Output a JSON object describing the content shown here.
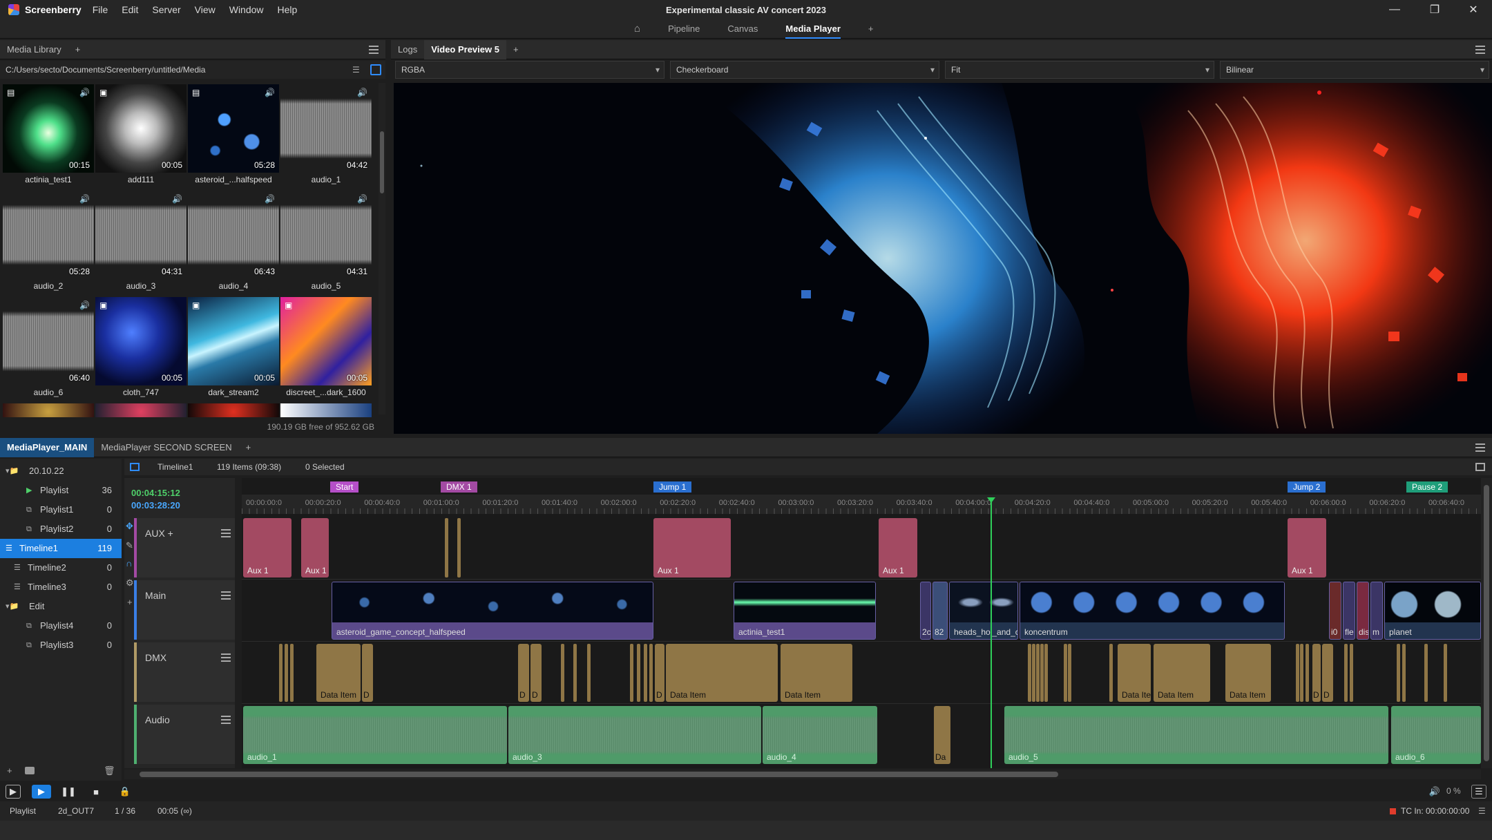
{
  "app": {
    "name": "Screenberry",
    "window_title": "Experimental classic AV concert 2023",
    "menu": [
      "File",
      "Edit",
      "Server",
      "View",
      "Window",
      "Help"
    ]
  },
  "workspace_tabs": [
    "Pipeline",
    "Canvas",
    "Media Player"
  ],
  "media_library": {
    "tab": "Media Library",
    "path": "C:/Users/secto/Documents/Screenberry/untitled/Media",
    "free_space": "190.19 GB free of 952.62 GB",
    "items": [
      {
        "name": "actinia_test1",
        "duration": "00:15"
      },
      {
        "name": "add111",
        "duration": "00:05"
      },
      {
        "name": "asteroid_...halfspeed",
        "duration": "05:28"
      },
      {
        "name": "audio_1",
        "duration": "04:42"
      },
      {
        "name": "audio_2",
        "duration": "05:28"
      },
      {
        "name": "audio_3",
        "duration": "04:31"
      },
      {
        "name": "audio_4",
        "duration": "06:43"
      },
      {
        "name": "audio_5",
        "duration": "04:31"
      },
      {
        "name": "audio_6",
        "duration": "06:40"
      },
      {
        "name": "cloth_747",
        "duration": "00:05"
      },
      {
        "name": "dark_stream2",
        "duration": "00:05"
      },
      {
        "name": "discreet_...dark_1600",
        "duration": "00:05"
      }
    ]
  },
  "preview": {
    "tabs": [
      "Logs",
      "Video Preview 5"
    ],
    "combos": [
      "RGBA",
      "Checkerboard",
      "Fit",
      "Bilinear"
    ]
  },
  "mediaplayer": {
    "tabs": [
      "MediaPlayer_MAIN",
      "MediaPlayer SECOND SCREEN"
    ],
    "tree": [
      {
        "label": "20.10.22",
        "count": ""
      },
      {
        "label": "Playlist",
        "count": "36"
      },
      {
        "label": "Playlist1",
        "count": "0"
      },
      {
        "label": "Playlist2",
        "count": "0"
      },
      {
        "label": "Timeline1",
        "count": "119"
      },
      {
        "label": "Timeline2",
        "count": "0"
      },
      {
        "label": "Timeline3",
        "count": "0"
      },
      {
        "label": "Edit",
        "count": ""
      },
      {
        "label": "Playlist4",
        "count": "0"
      },
      {
        "label": "Playlist3",
        "count": "0"
      }
    ],
    "timeline_name": "Timeline1",
    "items_info": "119 Items (09:38)",
    "selected_info": "0 Selected",
    "time_current": "00:04:15:12",
    "time_total": "00:03:28:20",
    "tracks": [
      "AUX +",
      "Main",
      "DMX",
      "Audio"
    ],
    "markers": [
      "Start",
      "DMX 1",
      "Jump 1",
      "Jump 2",
      "Pause 2"
    ],
    "ruler": [
      "00:00:00:0",
      "00:00:20:0",
      "00:00:40:0",
      "00:01:00:0",
      "00:01:20:0",
      "00:01:40:0",
      "00:02:00:0",
      "00:02:20:0",
      "00:02:40:0",
      "00:03:00:0",
      "00:03:20:0",
      "00:03:40:0",
      "00:04:00:0",
      "00:04:20:0",
      "00:04:40:0",
      "00:05:00:0",
      "00:05:20:0",
      "00:05:40:0",
      "00:06:00:0",
      "00:06:20:0",
      "00:06:40:0"
    ],
    "clips": {
      "aux": [
        "Aux 1",
        "Aux 1",
        "Aux 1",
        "Aux 1",
        "Aux 1"
      ],
      "main": [
        "asteroid_game_concept_halfspeed",
        "actinia_test1",
        "2c",
        "82",
        "heads_hol_and_c",
        "koncentrum",
        "i0",
        "fle",
        "dis",
        "m",
        "planet"
      ],
      "dmx": [
        "Data Item",
        "D",
        "D",
        "D",
        "D",
        "Data Item",
        "Data Item",
        "Data Ite",
        "Data Item",
        "Data Item",
        "D",
        "D"
      ],
      "audio": [
        "audio_1",
        "audio_3",
        "audio_4",
        "Da",
        "audio_5",
        "audio_6"
      ]
    }
  },
  "status": {
    "mode": "Playlist",
    "output": "2d_OUT7",
    "position": "1 / 36",
    "duration": "00:05 (∞)",
    "volume": "0 %",
    "tc": "TC In: 00:00:00:00"
  }
}
